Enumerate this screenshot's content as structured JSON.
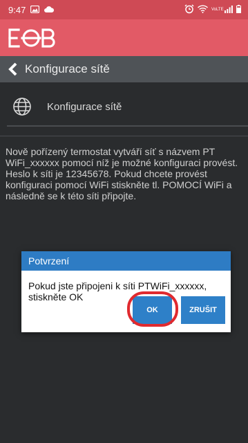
{
  "status_bar": {
    "time": "9:47",
    "network_label": "VoLTE"
  },
  "app": {
    "logo_text": "EOB"
  },
  "title_bar": {
    "title": "Konfigurace sítě"
  },
  "section": {
    "label": "Konfigurace sítě"
  },
  "description": "Nově pořízený termostat vytváří síť s názvem PT WiFi_xxxxxx pomocí níž je možné konfiguraci provést. Heslo k síti je 12345678. Pokud chcete provést konfiguraci pomocí  WiFi stiskněte tl. POMOCÍ WiFi a následně se k této síti připojte.",
  "dialog": {
    "title": "Potvrzení",
    "message": "Pokud jste připojeni k síti PTWiFi_xxxxxx, stiskněte OK",
    "ok_label": "OK",
    "cancel_label": "ZRUŠIT"
  },
  "colors": {
    "status_bar": "#cf4a55",
    "app_bar": "#e25a66",
    "title_bar": "#4f5357",
    "background": "#2a2c2e",
    "dialog_accent": "#2e7cc4",
    "highlight": "#e02a2f"
  }
}
